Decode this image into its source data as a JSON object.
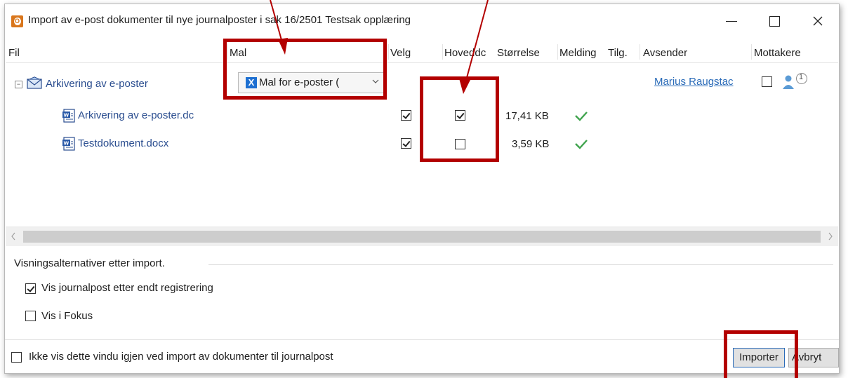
{
  "window": {
    "title": "Import av e-post dokumenter til nye journalposter i sak 16/2501 Testsak opplæring",
    "app_icon_letter": "O",
    "icons": [
      "outlook-icon",
      "minimize-icon",
      "maximize-icon",
      "close-icon"
    ]
  },
  "columns": {
    "fil": "Fil",
    "mal": "Mal",
    "velg": "Velg",
    "hoveddok": "Hoveddc",
    "storrelse": "Størrelse",
    "melding": "Melding",
    "tilg": "Tilg.",
    "avsender": "Avsender",
    "mottakere": "Mottakere"
  },
  "rows": {
    "email": {
      "expander": "−",
      "name": "Arkivering av e-poster",
      "template": "Mal for e-poster (",
      "template_icon_letter": "X",
      "sender": "Marius Raugstac",
      "recipient_count": "1",
      "selected": false
    },
    "doc1": {
      "name": "Arkivering av e-poster.dc",
      "selected": true,
      "main_document": true,
      "size": "17,41 KB"
    },
    "doc2": {
      "name": "Testdokument.docx",
      "selected": true,
      "main_document": false,
      "size": "3,59 KB"
    }
  },
  "options": {
    "group_label": "Visningsalternativer etter import.",
    "show_record": {
      "label": "Vis journalpost etter endt registrering",
      "checked": true
    },
    "show_focus": {
      "label": "Vis i Fokus",
      "checked": false
    }
  },
  "footer": {
    "dont_show": {
      "label": "Ikke vis dette vindu igjen ved import av dokumenter til journalpost",
      "checked": false
    },
    "import_label": "Importer",
    "cancel_label": "Avbryt"
  },
  "colors": {
    "annotation_red": "#b30000",
    "link_blue": "#2a6bb8",
    "check_green": "#3fa34d"
  }
}
